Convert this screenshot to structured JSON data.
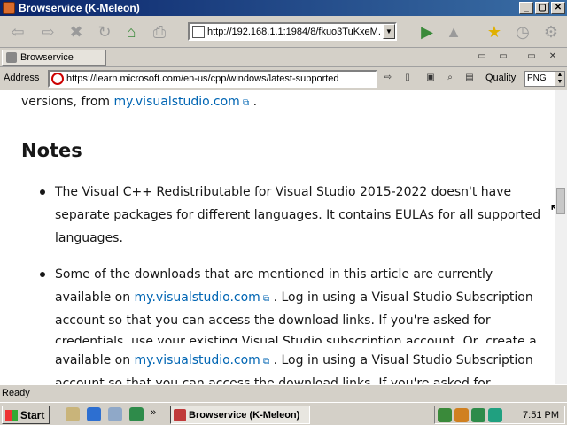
{
  "window": {
    "title": "Browservice (K-Meleon)",
    "buttons": [
      "_",
      "▢",
      "✕"
    ]
  },
  "toolbar": {
    "url_combo": "http://192.168.1.1:1984/8/fkuo3TuKxeM..."
  },
  "tab": {
    "label": "Browservice"
  },
  "address_bar": {
    "label": "Address",
    "url": "https://learn.microsoft.com/en-us/cpp/windows/latest-supported",
    "quality_label": "Quality",
    "quality_value": "PNG"
  },
  "content": {
    "line0": "versions, from ",
    "line0_link": "my.visualstudio.com",
    "line0_end": " .",
    "heading": "Notes",
    "b1_l1": "The Visual C++ Redistributable for Visual Studio 2015-2022 doesn't have",
    "b1_l2": "separate packages for different languages. It contains EULAs for all supported",
    "b1_l3": "languages.",
    "b2_l1": "Some of the downloads that are mentioned in this article are currently",
    "b2_l2_pre": "available on ",
    "b2_l2_link": "my.visualstudio.com",
    "b2_l2_post": " . Log in using a Visual Studio Subscription",
    "b2_l3": "account so that you can access the download links. If you're asked for",
    "b2_l4": "credentials, use your existing Visual Studio subscription account. Or, create a",
    "dup_l1_pre": "available on ",
    "dup_l1_link": "my.visualstudio.com",
    "dup_l1_post": " . Log in using a Visual Studio Subscription",
    "dup_l2": "account so that you can access the download links. If you're asked for"
  },
  "status": {
    "text": "Ready"
  },
  "taskbar": {
    "start": "Start",
    "task": "Browservice (K-Meleon)",
    "clock": "7:51 PM"
  }
}
